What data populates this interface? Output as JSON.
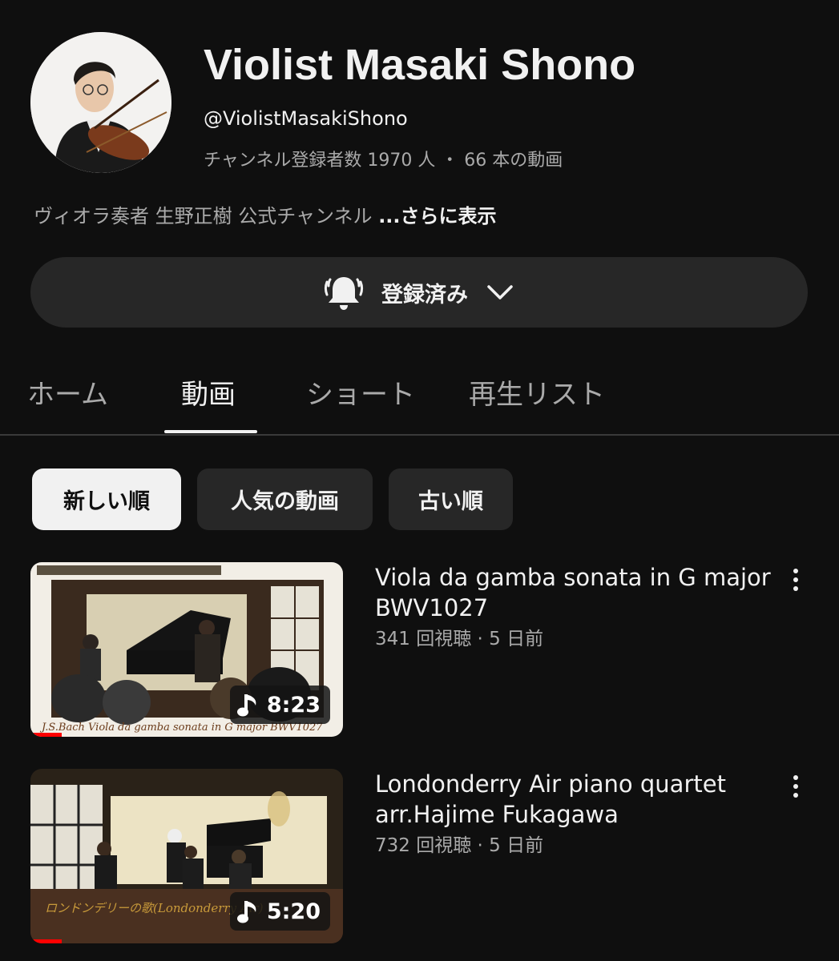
{
  "channel": {
    "name": "Violist Masaki Shono",
    "handle": "@ViolistMasakiShono",
    "stats": "チャンネル登録者数 1970 人 ・ 66 本の動画",
    "description": "ヴィオラ奏者 生野正樹 公式チャンネル",
    "more_label": "...さらに表示"
  },
  "subscribe": {
    "label": "登録済み",
    "bell_icon": "bell-icon",
    "chevron_icon": "chevron-down-icon"
  },
  "tabs": [
    {
      "label": "ホーム",
      "active": false
    },
    {
      "label": "動画",
      "active": true
    },
    {
      "label": "ショート",
      "active": false
    },
    {
      "label": "再生リスト",
      "active": false
    }
  ],
  "chips": [
    {
      "label": "新しい順",
      "selected": true
    },
    {
      "label": "人気の動画",
      "selected": false
    },
    {
      "label": "古い順",
      "selected": false
    }
  ],
  "videos": [
    {
      "title": "Viola da gamba sonata in G major BWV1027",
      "meta": "341 回視聴 · 5 日前",
      "duration": "8:23",
      "thumb_caption": "J.S.Bach Viola da gamba sonata in G major BWV1027",
      "watched_fraction": 0.1
    },
    {
      "title": "Londonderry Air  piano quartet arr.Hajime Fukagawa",
      "meta": "732 回視聴 · 5 日前",
      "duration": "5:20",
      "thumb_caption": "ロンドンデリーの歌(Londonderry Air)",
      "watched_fraction": 0.1
    }
  ],
  "colors": {
    "background": "#0f0f0f",
    "surface": "#272727",
    "text_primary": "#f1f1f1",
    "text_secondary": "#aaaaaa",
    "progress": "#ff0000"
  }
}
